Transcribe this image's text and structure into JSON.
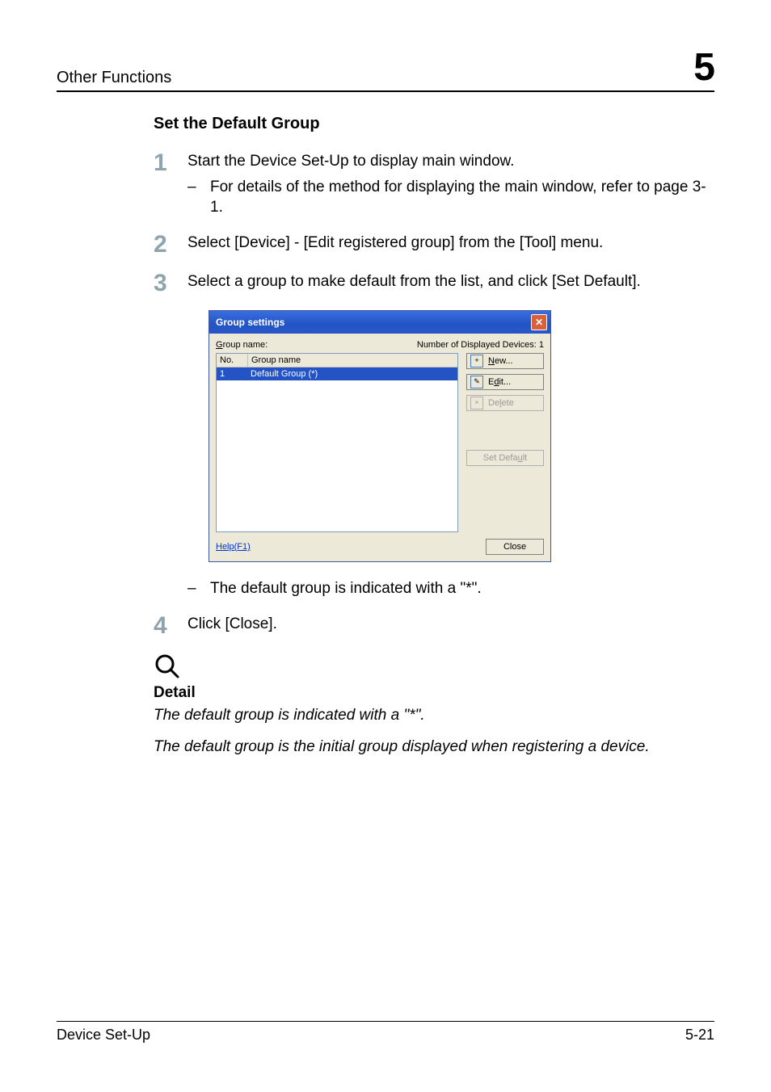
{
  "header": {
    "section": "Other Functions",
    "chapter": "5"
  },
  "section_title": "Set the Default Group",
  "steps": {
    "s1_num": "1",
    "s1_text": "Start the Device Set-Up to display main window.",
    "s1_sub": "For details of the method for displaying the main window, refer to page 3-1.",
    "s2_num": "2",
    "s2_text": "Select [Device] - [Edit registered group] from the [Tool] menu.",
    "s3_num": "3",
    "s3_text": "Select a group to make default from the list, and click [Set Default].",
    "s3_sub": "The default group is indicated with a \"*\".",
    "s4_num": "4",
    "s4_text": "Click [Close]."
  },
  "dialog": {
    "title": "Group settings",
    "group_name_label_pre": "G",
    "group_name_label_post": "roup name:",
    "disp_devices_label": "Number of Displayed Devices: 1",
    "col_no": "No.",
    "col_name": "Group name",
    "row_no": "1",
    "row_name": "Default Group (*)",
    "btn_new_u": "N",
    "btn_new_rest": "ew...",
    "btn_edit_pre": "E",
    "btn_edit_u": "d",
    "btn_edit_rest": "it...",
    "btn_delete_pre": "De",
    "btn_delete_u": "l",
    "btn_delete_rest": "ete",
    "btn_setdef_pre": "Set Defa",
    "btn_setdef_u": "u",
    "btn_setdef_rest": "lt",
    "help_label": "Help(F1)",
    "close_label": "Close"
  },
  "detail": {
    "heading": "Detail",
    "line1": "The default group is indicated with a \"*\".",
    "line2": "The default group is the initial group displayed when registering a device."
  },
  "footer": {
    "left": "Device Set-Up",
    "right": "5-21"
  }
}
